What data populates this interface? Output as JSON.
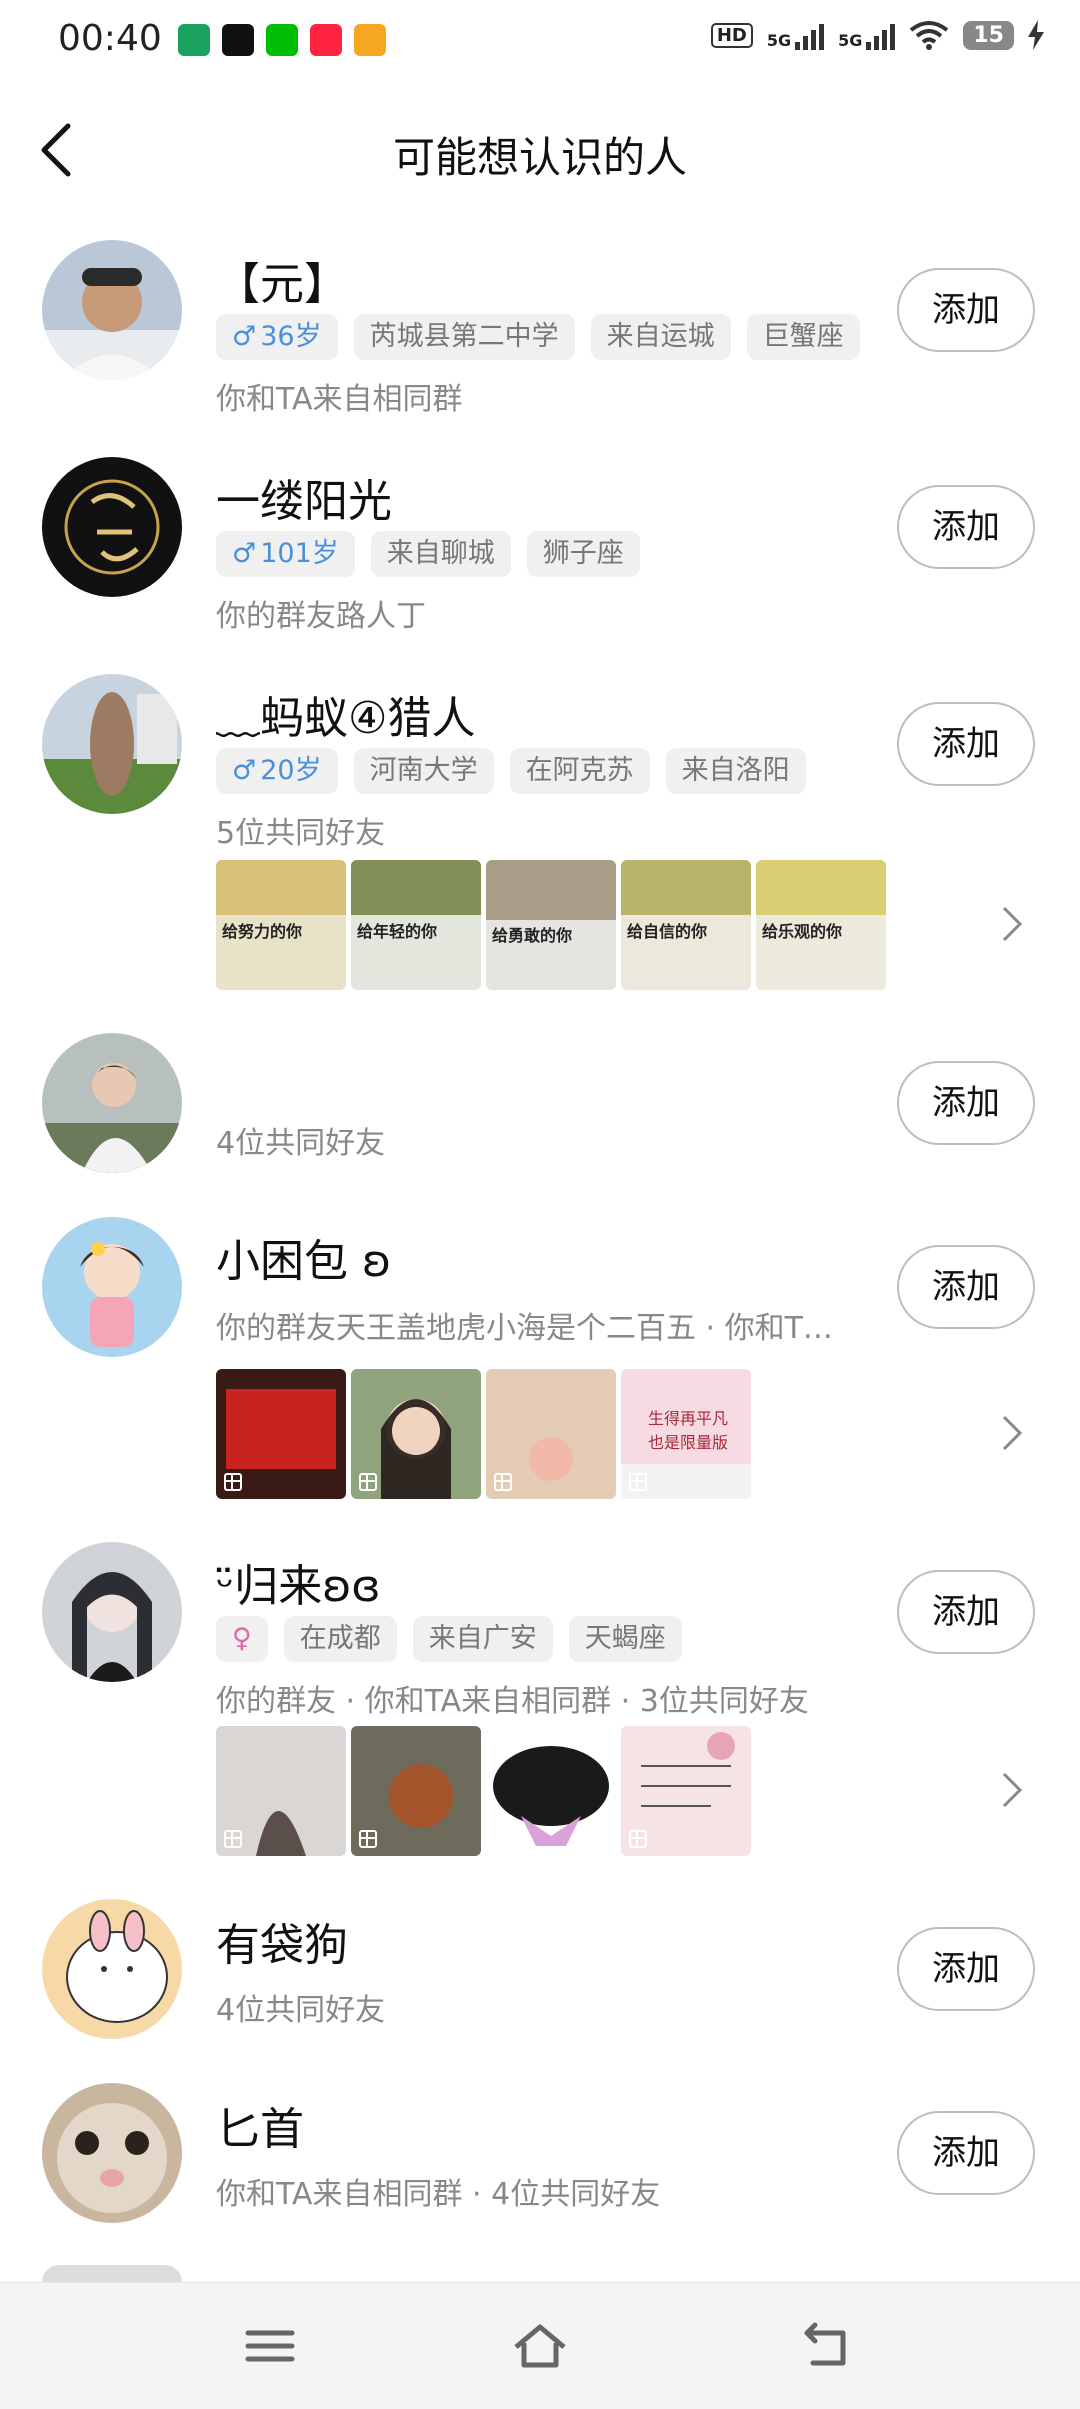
{
  "status": {
    "time": "00:40",
    "hd": "HD",
    "net1": "5G",
    "net2": "5G",
    "battery": "15"
  },
  "header": {
    "title": "可能想认识的人"
  },
  "people": [
    {
      "name": "【元】",
      "gender": "♂",
      "tags": [
        "36岁",
        "芮城县第二中学",
        "来自运城",
        "巨蟹座"
      ],
      "sub": "你和TA来自相同群",
      "button": "添加"
    },
    {
      "name": "一缕阳光",
      "gender": "♂",
      "tags": [
        "101岁",
        "来自聊城",
        "狮子座"
      ],
      "sub": "你的群友路人丁",
      "button": "添加"
    },
    {
      "name": "﹏蚂蚁④猎人",
      "gender": "♂",
      "tags": [
        "20岁",
        "河南大学",
        "在阿克苏",
        "来自洛阳"
      ],
      "sub": "5位共同好友",
      "button": "添加",
      "photos": [
        "给努力的你",
        "给年轻的你",
        "给勇敢的你",
        "给自信的你",
        "给乐观的你"
      ]
    },
    {
      "name": "",
      "sub": "4位共同好友",
      "button": "添加"
    },
    {
      "name": "小困包 ʚ",
      "sub": "你的群友天王盖地虎小海是个二百五 · 你和T…",
      "button": "添加",
      "photos": [
        "",
        "",
        "",
        "生得再平凡 也是限量版"
      ]
    },
    {
      "name": "ᵕ̈归来ʚɞ",
      "gender": "♀",
      "tags": [
        "在成都",
        "来自广安",
        "天蝎座"
      ],
      "sub": "你的群友       · 你和TA来自相同群 · 3位共同好友",
      "button": "添加",
      "photos": [
        "",
        "",
        "",
        ""
      ]
    },
    {
      "name": "有袋狗",
      "sub": "4位共同好友",
      "button": "添加"
    },
    {
      "name": "匕首",
      "sub": "你和TA来自相同群 · 4位共同好友",
      "button": "添加"
    }
  ],
  "icons": [
    "back-icon",
    "chevron-right-icon",
    "menu-icon",
    "home-icon",
    "back-nav-icon"
  ]
}
